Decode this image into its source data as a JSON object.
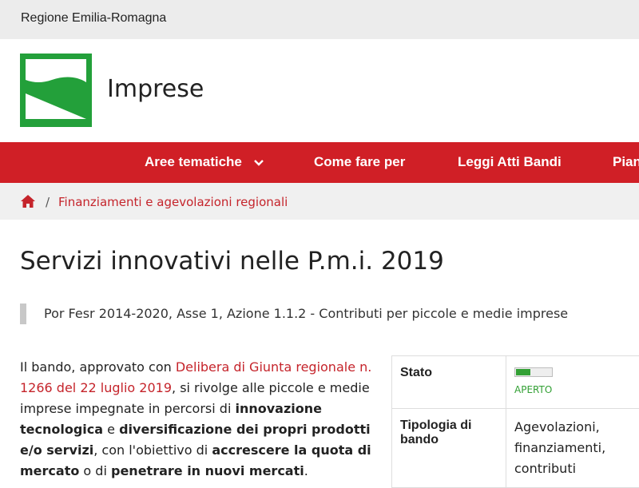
{
  "header": {
    "region": "Regione Emilia-Romagna",
    "site_title": "Imprese"
  },
  "colors": {
    "accent": "#d01f26",
    "logo_green": "#23a03a",
    "status_green": "#33a035"
  },
  "nav": {
    "items": [
      {
        "label": "Aree tematiche",
        "has_dropdown": true
      },
      {
        "label": "Come fare per"
      },
      {
        "label": "Leggi Atti Bandi"
      },
      {
        "label": "Pian"
      }
    ]
  },
  "breadcrumb": {
    "home_icon": "home-icon",
    "separator": "/",
    "current": "Finanziamenti e agevolazioni regionali"
  },
  "page": {
    "title": "Servizi innovativi nelle P.m.i. 2019",
    "lead": "Por Fesr 2014-2020, Asse 1, Azione 1.1.2 - Contributi per piccole e medie imprese"
  },
  "body": {
    "t1": "Il bando, approvato con ",
    "link": "Delibera di Giunta regionale n. 1266 del 22 luglio 2019",
    "t2": ", si rivolge alle piccole e medie imprese impegnate in percorsi di ",
    "b1": "innovazione tecnologica",
    "t3": " e ",
    "b2": "diversificazione dei propri prodotti e/o servizi",
    "t4": ", con l'obiettivo di ",
    "b3": "accrescere la quota di mercato",
    "t5": " o di ",
    "b4": "penetrare in nuovi mercati",
    "t6": "."
  },
  "info_table": {
    "stato_label": "Stato",
    "stato_value": "APERTO",
    "stato_fill_fraction": 0.4,
    "tipologia_label": "Tipologia di bando",
    "tipologia_value": "Agevolazioni, finanziamenti, contributi"
  }
}
